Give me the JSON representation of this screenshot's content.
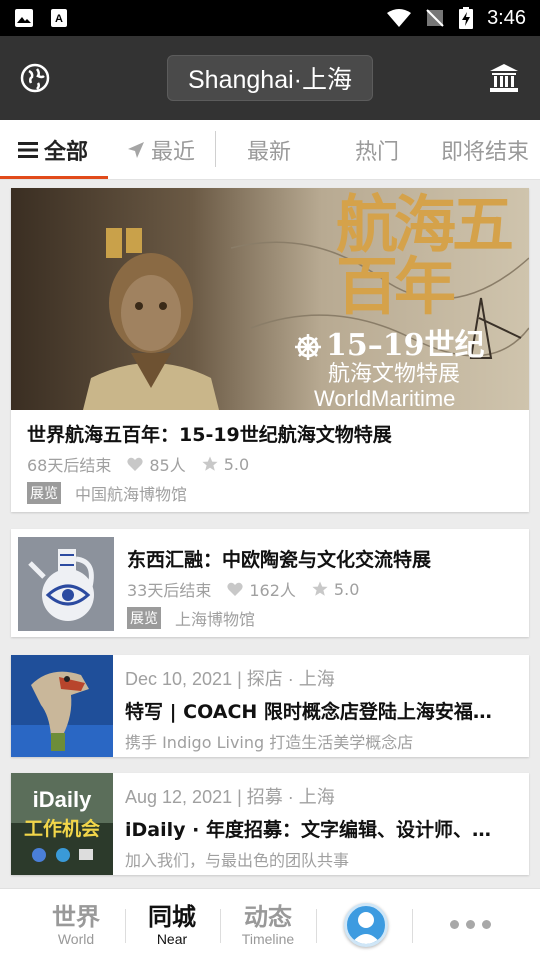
{
  "status_bar": {
    "time": "3:46"
  },
  "header": {
    "city": "Shanghai·上海"
  },
  "tabs": [
    {
      "label": "全部",
      "icon": "list-icon",
      "active": true
    },
    {
      "label": "最近",
      "icon": "location-arrow-icon"
    },
    {
      "label": "最新"
    },
    {
      "label": "热门"
    },
    {
      "label": "即将结束"
    }
  ],
  "exhibitions": [
    {
      "banner": {
        "big_text": "航海五百年",
        "century": "15–19世纪",
        "subtitle": "航海文物特展",
        "english": "WorldMaritime"
      },
      "title": "世界航海五百年：15-19世纪航海文物特展",
      "days_left": "68天后结束",
      "likes": "85人",
      "rating": "5.0",
      "tag": "展览",
      "venue": "中国航海博物馆"
    },
    {
      "title": "东西汇融：中欧陶瓷与文化交流特展",
      "days_left": "33天后结束",
      "likes": "162人",
      "rating": "5.0",
      "tag": "展览",
      "venue": "上海博物馆"
    }
  ],
  "articles": [
    {
      "date_line": "Dec 10, 2021 | 探店 · 上海",
      "title": "特写 | COACH 限时概念店登陆上海安福…",
      "subtitle": "携手 Indigo Living 打造生活美学概念店"
    },
    {
      "thumb_text": [
        "iDaily",
        "工作机会"
      ],
      "date_line": "Aug 12, 2021 | 招募 · 上海",
      "title": "iDaily · 年度招募：文字编辑、设计师、…",
      "subtitle": "加入我们，与最出色的团队共事"
    }
  ],
  "bottom_nav": [
    {
      "cn": "世界",
      "en": "World"
    },
    {
      "cn": "同城",
      "en": "Near",
      "active": true
    },
    {
      "cn": "动态",
      "en": "Timeline"
    }
  ],
  "colors": {
    "accent": "#e14a1a",
    "header_bg": "#333333",
    "page_bg": "#ececec"
  }
}
